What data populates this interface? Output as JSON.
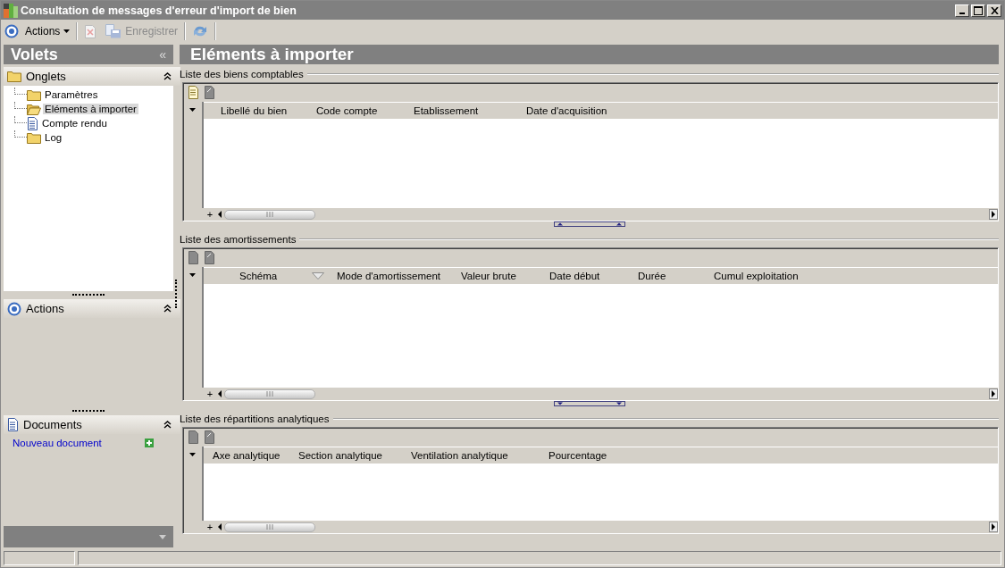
{
  "window": {
    "title": "Consultation de messages d'erreur d'import de bien"
  },
  "toolbar": [
    {
      "kind": "menu",
      "label": "Actions",
      "disabled": false
    },
    {
      "kind": "delete",
      "disabled": true
    },
    {
      "kind": "save",
      "label": "Enregistrer",
      "disabled": true
    },
    {
      "kind": "refresh",
      "disabled": false
    }
  ],
  "sidebar": {
    "title": "Volets",
    "collapse": "«",
    "panes": [
      {
        "kind": "tabs",
        "title": "Onglets",
        "expanded": true,
        "items": [
          {
            "label": "Paramètres",
            "kind": "folder",
            "selected": false
          },
          {
            "label": "Eléments à importer",
            "kind": "folder-open",
            "selected": true
          },
          {
            "label": "Compte rendu",
            "kind": "document",
            "selected": false
          },
          {
            "label": "Log",
            "kind": "folder",
            "selected": false
          }
        ]
      },
      {
        "kind": "actions",
        "title": "Actions",
        "expanded": true
      },
      {
        "kind": "documents",
        "title": "Documents",
        "expanded": true,
        "links": [
          {
            "label": "Nouveau document"
          }
        ]
      }
    ]
  },
  "content": {
    "title": "Eléments à importer",
    "sections": [
      {
        "title": "Liste des biens comptables",
        "add_row": "+",
        "buttons": [
          {
            "kind": "new",
            "disabled": false
          },
          {
            "kind": "edit",
            "disabled": true
          }
        ],
        "columns": [
          {
            "label": "Libellé du bien",
            "filter": false
          },
          {
            "label": "Code compte",
            "filter": false
          },
          {
            "label": "Etablissement",
            "filter": false
          },
          {
            "label": "Date d'acquisition",
            "filter": false
          }
        ]
      },
      {
        "title": "Liste des amortissements",
        "add_row": "+",
        "buttons": [
          {
            "kind": "new",
            "disabled": true
          },
          {
            "kind": "edit",
            "disabled": true
          }
        ],
        "columns": [
          {
            "label": "Schéma",
            "filter": true
          },
          {
            "label": "Mode d'amortissement",
            "filter": false
          },
          {
            "label": "Valeur brute",
            "filter": false
          },
          {
            "label": "Date début",
            "filter": false
          },
          {
            "label": "Durée",
            "filter": false
          },
          {
            "label": "Cumul exploitation",
            "filter": false
          }
        ]
      },
      {
        "title": "Liste des répartitions analytiques",
        "add_row": "+",
        "buttons": [
          {
            "kind": "new",
            "disabled": true
          },
          {
            "kind": "edit",
            "disabled": true
          }
        ],
        "columns": [
          {
            "label": "Axe analytique",
            "filter": false
          },
          {
            "label": "Section analytique",
            "filter": false
          },
          {
            "label": "Ventilation analytique",
            "filter": false
          },
          {
            "label": "Pourcentage",
            "filter": false
          }
        ]
      }
    ]
  }
}
